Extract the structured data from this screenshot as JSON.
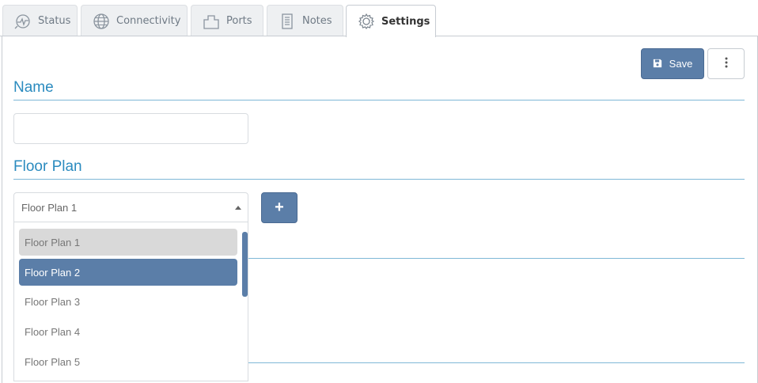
{
  "tabs": [
    {
      "label": "Status",
      "icon": "status-pulse-icon"
    },
    {
      "label": "Connectivity",
      "icon": "globe-icon"
    },
    {
      "label": "Ports",
      "icon": "ports-icon"
    },
    {
      "label": "Notes",
      "icon": "notes-icon"
    },
    {
      "label": "Settings",
      "icon": "gear-icon"
    }
  ],
  "active_tab": "Settings",
  "toolbar": {
    "save_label": "Save",
    "more_icon": "vertical-ellipsis-icon"
  },
  "sections": {
    "name": {
      "title": "Name",
      "value": "",
      "placeholder": ""
    },
    "floor_plan": {
      "title": "Floor Plan",
      "selected": "Floor Plan 1",
      "add_label": "+",
      "options": [
        "Floor Plan 1",
        "Floor Plan 2",
        "Floor Plan 3",
        "Floor Plan 4",
        "Floor Plan 5"
      ],
      "hovered_option": "Floor Plan 1",
      "highlighted_option": "Floor Plan 2"
    }
  },
  "colors": {
    "accent": "#5b7ea8",
    "heading": "#2b8bbf"
  }
}
